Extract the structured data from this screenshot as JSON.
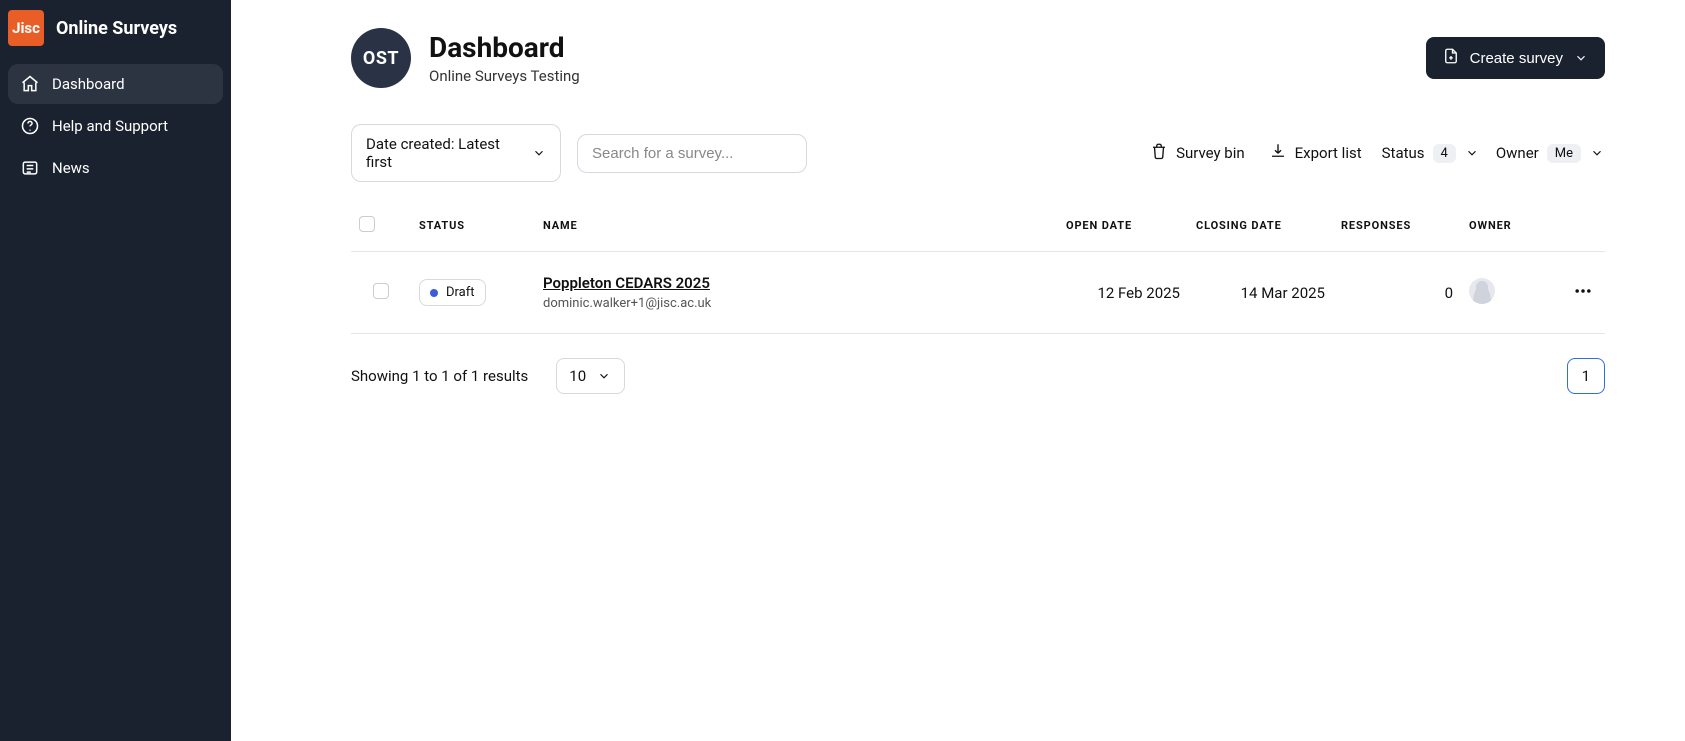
{
  "brand": {
    "logo_text": "Jisc",
    "title": "Online Surveys"
  },
  "sidebar": {
    "items": [
      {
        "id": "dashboard",
        "label": "Dashboard"
      },
      {
        "id": "help",
        "label": "Help and Support"
      },
      {
        "id": "news",
        "label": "News"
      }
    ],
    "active_id": "dashboard"
  },
  "header": {
    "org_avatar": "OST",
    "title": "Dashboard",
    "subtitle": "Online Surveys Testing",
    "create_button": "Create survey"
  },
  "toolbar": {
    "sort_label": "Date created: Latest first",
    "search_placeholder": "Search for a survey...",
    "survey_bin": "Survey bin",
    "export_list": "Export list",
    "status_label": "Status",
    "status_count": "4",
    "owner_label": "Owner",
    "owner_badge": "Me"
  },
  "table": {
    "columns": {
      "status": "Status",
      "name": "Name",
      "open_date": "Open Date",
      "closing_date": "Closing Date",
      "responses": "Responses",
      "owner": "Owner"
    },
    "rows": [
      {
        "status_label": "Draft",
        "status_color": "#3b5bdb",
        "name": "Poppleton CEDARS 2025",
        "sub": "dominic.walker+1@jisc.ac.uk",
        "open_date": "12 Feb 2025",
        "closing_date": "14 Mar 2025",
        "responses": "0"
      }
    ]
  },
  "footer": {
    "results_info": "Showing 1 to 1 of 1 results",
    "page_size": "10",
    "current_page": "1"
  }
}
